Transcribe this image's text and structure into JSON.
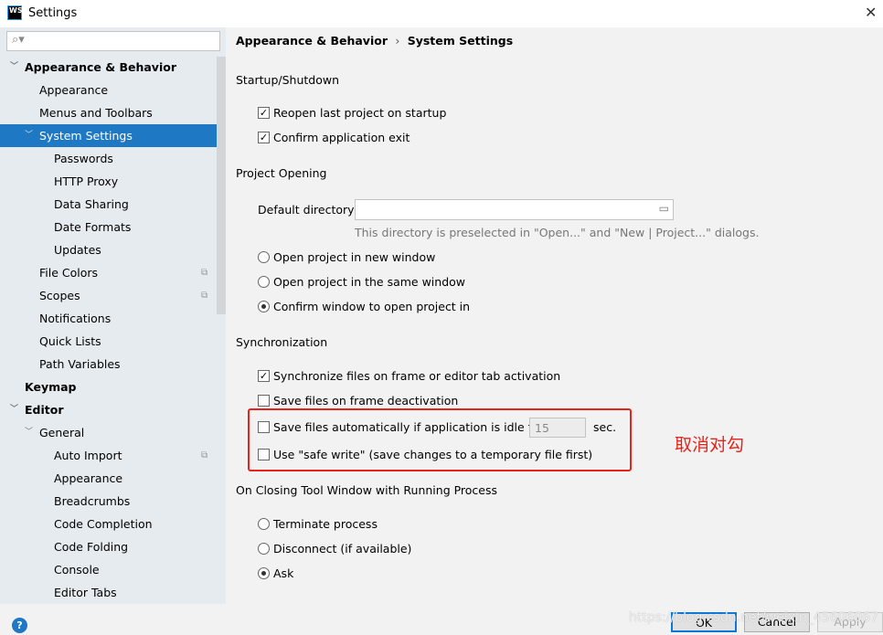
{
  "window": {
    "title": "Settings",
    "logo": "WS",
    "close": "✕"
  },
  "search": {
    "placeholder": "",
    "icon": "search-icon"
  },
  "tree": [
    {
      "label": "Appearance & Behavior",
      "level": 0,
      "bold": true,
      "expanded": true
    },
    {
      "label": "Appearance",
      "level": 1
    },
    {
      "label": "Menus and Toolbars",
      "level": 1
    },
    {
      "label": "System Settings",
      "level": 1,
      "selected": true,
      "expanded": true
    },
    {
      "label": "Passwords",
      "level": 2
    },
    {
      "label": "HTTP Proxy",
      "level": 2
    },
    {
      "label": "Data Sharing",
      "level": 2
    },
    {
      "label": "Date Formats",
      "level": 2
    },
    {
      "label": "Updates",
      "level": 2
    },
    {
      "label": "File Colors",
      "level": 1,
      "copy": true
    },
    {
      "label": "Scopes",
      "level": 1,
      "copy": true
    },
    {
      "label": "Notifications",
      "level": 1
    },
    {
      "label": "Quick Lists",
      "level": 1
    },
    {
      "label": "Path Variables",
      "level": 1
    },
    {
      "label": "Keymap",
      "level": 0,
      "bold": true
    },
    {
      "label": "Editor",
      "level": 0,
      "bold": true,
      "expanded": true
    },
    {
      "label": "General",
      "level": 1,
      "expanded": true
    },
    {
      "label": "Auto Import",
      "level": 2,
      "copy": true
    },
    {
      "label": "Appearance",
      "level": 2
    },
    {
      "label": "Breadcrumbs",
      "level": 2
    },
    {
      "label": "Code Completion",
      "level": 2
    },
    {
      "label": "Code Folding",
      "level": 2
    },
    {
      "label": "Console",
      "level": 2
    },
    {
      "label": "Editor Tabs",
      "level": 2
    }
  ],
  "breadcrumb": {
    "parent": "Appearance & Behavior",
    "sep": "›",
    "current": "System Settings"
  },
  "startup": {
    "title": "Startup/Shutdown",
    "reopen": "Reopen last project on startup",
    "reopen_checked": true,
    "confirm_exit": "Confirm application exit",
    "confirm_exit_checked": true
  },
  "project_opening": {
    "title": "Project Opening",
    "dir_label": "Default directory:",
    "dir_value": "",
    "hint": "This directory is preselected in \"Open...\" and \"New | Project...\" dialogs.",
    "options": [
      "Open project in new window",
      "Open project in the same window",
      "Confirm window to open project in"
    ],
    "selected": 2
  },
  "sync": {
    "title": "Synchronization",
    "sync_files": "Synchronize files on frame or editor tab activation",
    "sync_files_checked": true,
    "save_deactivation": "Save files on frame deactivation",
    "save_deactivation_checked": false,
    "save_idle": "Save files automatically if application is idle for",
    "save_idle_checked": false,
    "idle_value": "15",
    "idle_unit": "sec.",
    "safe_write": "Use \"safe write\" (save changes to a temporary file first)",
    "safe_write_checked": false
  },
  "annotation": {
    "text": "取消对勾",
    "color": "#e8231a"
  },
  "closing": {
    "title": "On Closing Tool Window with Running Process",
    "options": [
      "Terminate process",
      "Disconnect (if available)",
      "Ask"
    ],
    "selected": 2
  },
  "buttons": {
    "help": "?",
    "ok": "OK",
    "cancel": "Cancel",
    "apply": "Apply"
  },
  "watermark": "https://blog.csdn.net/weixin_45606067",
  "colors": {
    "selection": "#1e78c4",
    "sidebar": "#e6ebf0"
  }
}
